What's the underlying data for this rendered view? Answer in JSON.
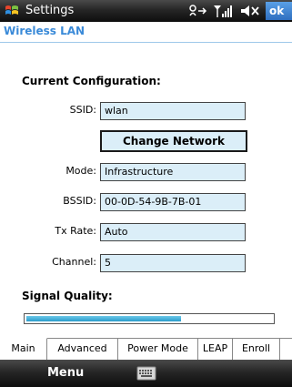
{
  "titlebar": {
    "title": "Settings",
    "ok_label": "ok"
  },
  "subheader": {
    "title": "Wireless LAN"
  },
  "config": {
    "section_title": "Current Configuration:",
    "ssid_label": "SSID:",
    "ssid_value": "wlan",
    "change_button": "Change Network",
    "mode_label": "Mode:",
    "mode_value": "Infrastructure",
    "bssid_label": "BSSID:",
    "bssid_value": "00-0D-54-9B-7B-01",
    "txrate_label": "Tx Rate:",
    "txrate_value": "Auto",
    "channel_label": "Channel:",
    "channel_value": "5"
  },
  "signal": {
    "section_title": "Signal Quality:",
    "level_fraction": 0.63
  },
  "tabs": [
    "Main",
    "Advanced",
    "Power Mode",
    "LEAP",
    "Enroll"
  ],
  "active_tab": "Main",
  "bottombar": {
    "menu_label": "Menu"
  },
  "icons": {
    "start": "windows-flag-icon",
    "connectivity": "connectivity-icon",
    "signal": "signal-bars-icon",
    "volume": "speaker-icon",
    "keyboard": "keyboard-icon"
  },
  "colors": {
    "accent_text": "#3a8ad8",
    "field_bg": "#dbeef8",
    "ok_bg": "#2f6fc0"
  }
}
